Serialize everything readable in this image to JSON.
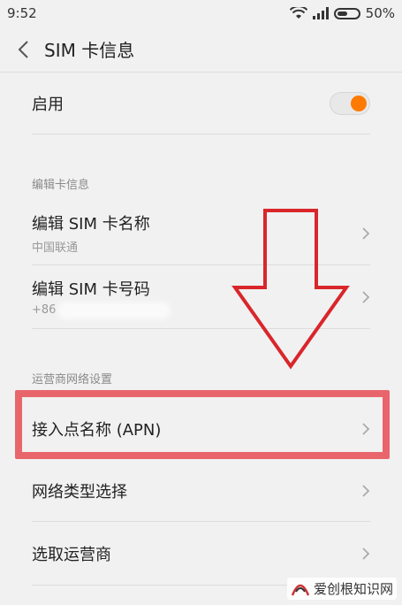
{
  "status": {
    "time": "9:52",
    "battery": "50%",
    "battery_level": 0.5
  },
  "header": {
    "title": "SIM 卡信息"
  },
  "enable_row": {
    "label": "启用",
    "enabled": true
  },
  "section_card": {
    "header": "编辑卡信息"
  },
  "edit_name": {
    "label": "编辑 SIM 卡名称",
    "value": "中国联通"
  },
  "edit_number": {
    "label": "编辑 SIM 卡号码",
    "value": "+86"
  },
  "section_network": {
    "header": "运营商网络设置"
  },
  "apn": {
    "label": "接入点名称 (APN)"
  },
  "network_type": {
    "label": "网络类型选择"
  },
  "operator": {
    "label": "选取运营商"
  },
  "watermark": {
    "text": "爱创根知识网"
  },
  "colors": {
    "toggle_on": "#ff7a00",
    "highlight": "#e8666b",
    "arrow": "#d9262b"
  }
}
